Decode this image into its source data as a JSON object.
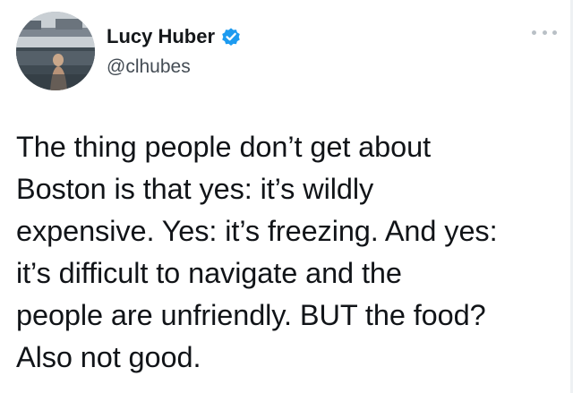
{
  "author": {
    "display_name": "Lucy Huber",
    "handle": "@clhubes",
    "verified": true,
    "verified_color": "#1d9bf0"
  },
  "menu": {
    "icon": "more-horizontal-icon"
  },
  "tweet": {
    "lines": [
      "The thing people don’t get about",
      "Boston is that yes: it’s wildly",
      "expensive. Yes: it’s freezing. And yes:",
      "it’s difficult to navigate and the",
      "people are unfriendly. BUT the food?",
      "Also not good."
    ]
  }
}
